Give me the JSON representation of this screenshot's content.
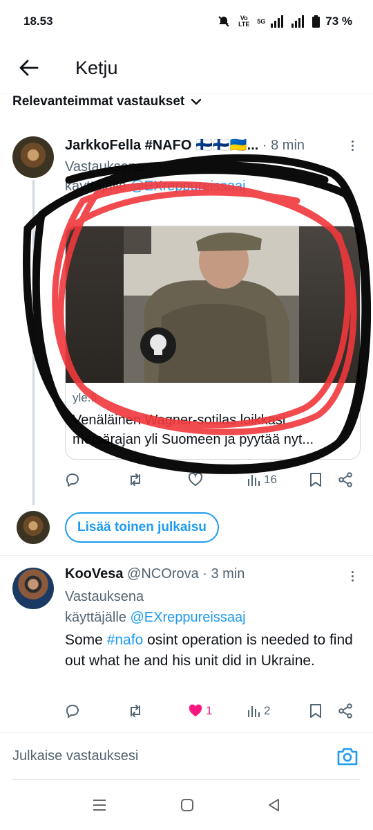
{
  "status": {
    "time": "18.53",
    "network": "5G",
    "volte": "Vo LTE",
    "battery": "73 %"
  },
  "header": {
    "title": "Ketju",
    "back_icon": "arrow-left-icon"
  },
  "sort": {
    "label": "Relevanteimmat vastaukset",
    "icon": "chevron-down-icon"
  },
  "tweets": [
    {
      "name": "JarkkoFella #NAFO 🇫🇮🇫🇮🇺🇦...",
      "time": "· 8 min",
      "reply_prefix": "Vastauksena",
      "reply_line2_prefix": "käyttäjälle ",
      "reply_to": "@EXreppureissaaj",
      "card": {
        "domain": "yle.fi",
        "title": "Venäläinen Wagner-sotilas loikkasi metsärajan yli Suomeen ja pyytää nyt..."
      },
      "stats": {
        "views": "16"
      }
    },
    {
      "name": "KooVesa",
      "handle": "@NCOrova",
      "time": "· 3 min",
      "reply_prefix": "Vastauksena",
      "reply_line2_prefix": "käyttäjälle ",
      "reply_to": "@EXreppureissaaj",
      "text_before": "Some ",
      "hashtag": "#nafo",
      "text_after": " osint operation is needed to find out what he and his unit did in Ukraine.",
      "stats": {
        "likes": "1",
        "views": "2"
      }
    }
  ],
  "add_post": {
    "label": "Lisää toinen julkaisu"
  },
  "composer": {
    "placeholder": "Julkaise vastauksesi"
  },
  "colors": {
    "accent": "#1d9bf0",
    "like": "#f91880",
    "annotation_red": "#f0383c",
    "annotation_black": "#000000"
  }
}
